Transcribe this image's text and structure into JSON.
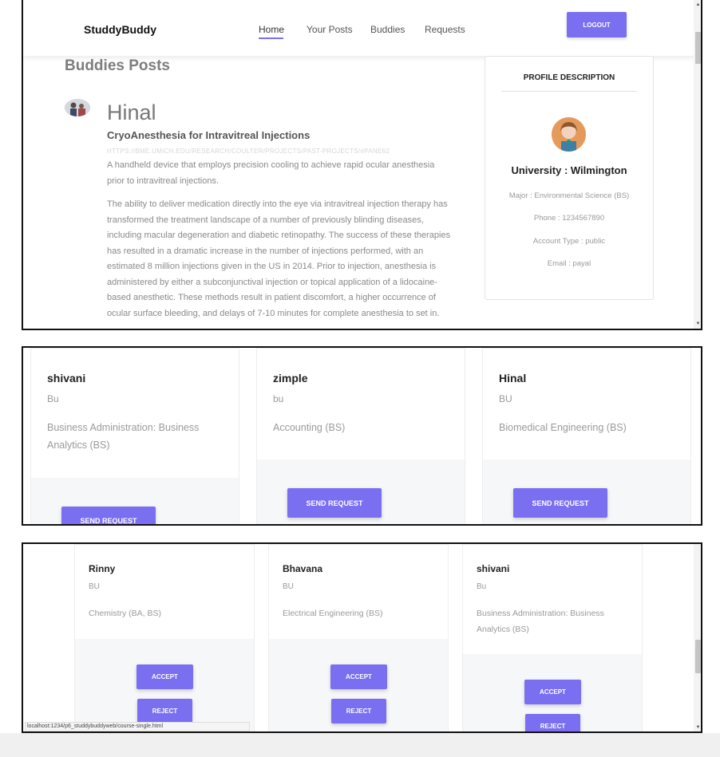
{
  "navbar": {
    "brand": "StuddyBuddy",
    "links": [
      "Home",
      "Your Posts",
      "Buddies",
      "Requests"
    ],
    "logout_label": "LOGOUT",
    "accent_color": "#7a6ff0"
  },
  "posts_section": {
    "title": "Buddies Posts",
    "post": {
      "author": "Hinal",
      "title": "CryoAnesthesia for Intravitreal Injections",
      "link": "HTTPS://BME.UMICH.EDU/RESEARCH/COULTER/PROJECTS/PAST-PROJECTS/#PANE62",
      "summary": "A handheld device that employs precision cooling to achieve rapid ocular anesthesia prior to intravitreal injections.",
      "body": "The ability to deliver medication directly into the eye via intravitreal injection therapy has transformed the treatment landscape of a number of previously blinding diseases, including macular degeneration and diabetic retinopathy. The success of these therapies has resulted in a dramatic increase in the number of injections performed, with an estimated 8 million injections given in the US in 2014. Prior to injection, anesthesia is administered by either a subconjunctival injection or topical application of a lidocaine-based anesthetic. These methods result in patient discomfort, a higher occurrence of ocular surface bleeding, and delays of 7-10 minutes for complete anesthesia to set in."
    }
  },
  "profile": {
    "heading": "PROFILE DESCRIPTION",
    "university": "University : Wilmington",
    "major": "Major : Environmental Science (BS)",
    "phone": "Phone : 1234567890",
    "account_type": "Account Type : public",
    "email": "Email : payal"
  },
  "buddies": [
    {
      "name": "shivani",
      "university": "Bu",
      "major": "Business Administration: Business Analytics (BS)",
      "button": "SEND REQUEST"
    },
    {
      "name": "zimple",
      "university": "bu",
      "major": "Accounting (BS)",
      "button": "SEND REQUEST"
    },
    {
      "name": "Hinal",
      "university": "BU",
      "major": "Biomedical Engineering (BS)",
      "button": "SEND REQUEST"
    }
  ],
  "requests": [
    {
      "name": "Rinny",
      "university": "BU",
      "major": "Chemistry (BA, BS)",
      "accept": "ACCEPT",
      "reject": "REJECT"
    },
    {
      "name": "Bhavana",
      "university": "BU",
      "major": "Electrical Engineering (BS)",
      "accept": "ACCEPT",
      "reject": "REJECT"
    },
    {
      "name": "shivani",
      "university": "Bu",
      "major": "Business Administration: Business Analytics (BS)",
      "accept": "ACCEPT",
      "reject": "REJECT"
    }
  ],
  "status_bar": {
    "url": "localhost:1234/p6_studdybuddyweb/course-single.html"
  }
}
